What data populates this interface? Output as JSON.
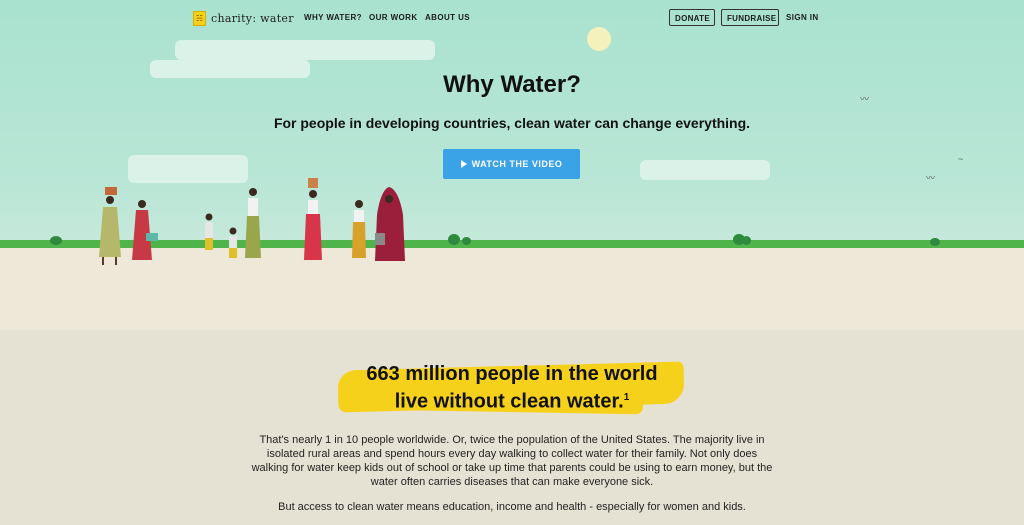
{
  "nav": {
    "logo_text": "charity: water",
    "links": [
      "WHY WATER?",
      "OUR WORK",
      "ABOUT US"
    ],
    "donate": "DONATE",
    "fundraise": "FUNDRAISE",
    "sign_in": "SIGN IN"
  },
  "hero": {
    "title": "Why Water?",
    "subtitle": "For people in developing countries, clean water can change everything.",
    "cta": "WATCH THE VIDEO"
  },
  "stat": {
    "line1": "663 million people in the world",
    "line2": "live without clean water.",
    "footnote": "1"
  },
  "body": {
    "paragraph1": "That's nearly 1 in 10 people worldwide. Or, twice the population of the United States. The majority live in isolated rural areas and spend hours every day walking to collect water for their family. Not only does walking for water keep kids out of school or take up time that parents could be using to earn money, but the water often carries diseases that can make everyone sick.",
    "paragraph2": "But access to clean water means education, income and health - especially for women and kids."
  },
  "colors": {
    "sky": "#b9e6d6",
    "grass": "#4fb54a",
    "sand": "#ede8d8",
    "cta": "#3aa3e8",
    "highlight": "#f6d11b"
  }
}
